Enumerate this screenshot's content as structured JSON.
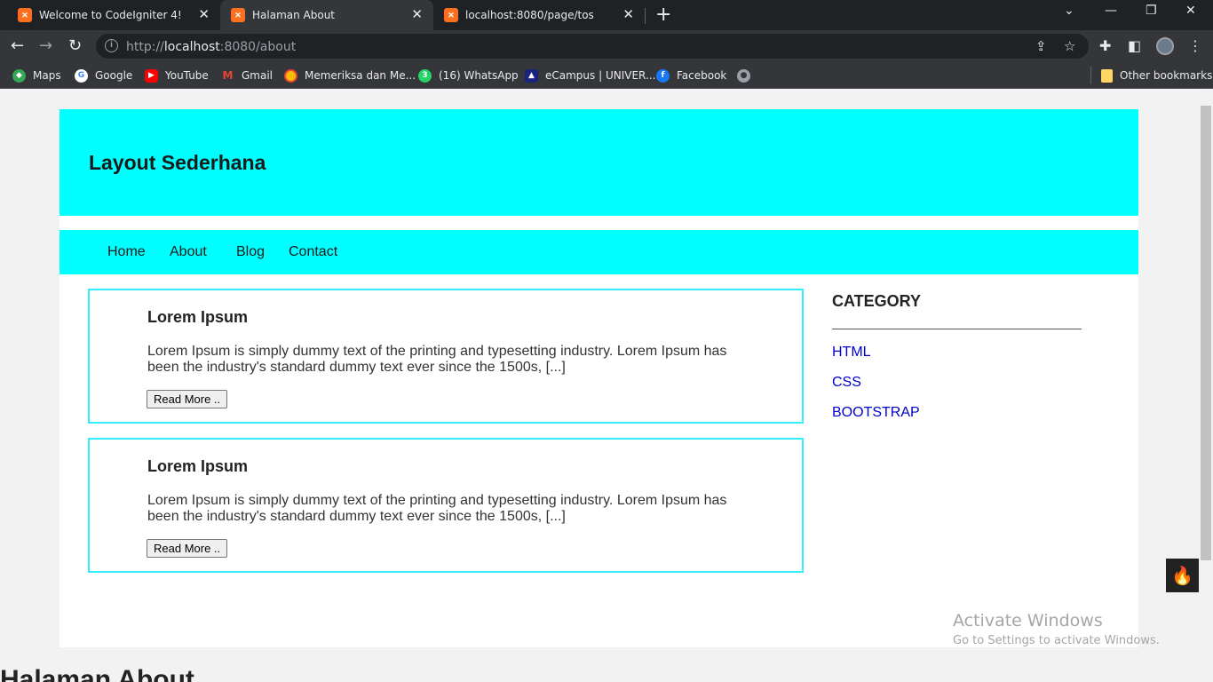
{
  "browser": {
    "tabs": [
      {
        "title": "Welcome to CodeIgniter 4!",
        "favicon": "xampp-icon",
        "active": false
      },
      {
        "title": "Halaman About",
        "favicon": "xampp-icon",
        "active": true
      },
      {
        "title": "localhost:8080/page/tos",
        "favicon": "xampp-icon",
        "active": false
      }
    ],
    "address": {
      "scheme": "http://",
      "host": "localhost",
      "rest": ":8080/about"
    },
    "bookmarks": [
      {
        "label": "Maps",
        "icon": "maps-icon"
      },
      {
        "label": "Google",
        "icon": "google-icon"
      },
      {
        "label": "YouTube",
        "icon": "youtube-icon"
      },
      {
        "label": "Gmail",
        "icon": "gmail-icon"
      },
      {
        "label": "Memeriksa dan Me...",
        "icon": "chrome-icon"
      },
      {
        "label": "(16) WhatsApp",
        "icon": "whatsapp-icon"
      },
      {
        "label": "eCampus | UNIVER...",
        "icon": "campus-icon"
      },
      {
        "label": "Facebook",
        "icon": "facebook-icon"
      },
      {
        "label": "",
        "icon": "globe-icon"
      }
    ],
    "other_bookmarks": "Other bookmarks"
  },
  "page": {
    "header_title": "Layout Sederhana",
    "nav": [
      "Home",
      "About",
      "Blog",
      "Contact"
    ],
    "articles": [
      {
        "title": "Lorem Ipsum",
        "body": "Lorem Ipsum is simply dummy text of the printing and typesetting industry. Lorem Ipsum has been the industry's standard dummy text ever since the 1500s, [...]",
        "button": "Read More .."
      },
      {
        "title": "Lorem Ipsum",
        "body": "Lorem Ipsum is simply dummy text of the printing and typesetting industry. Lorem Ipsum has been the industry's standard dummy text ever since the 1500s, [...]",
        "button": "Read More .."
      }
    ],
    "sidebar": {
      "heading": "CATEGORY",
      "links": [
        "HTML",
        "CSS",
        "BOOTSTRAP"
      ]
    },
    "bottom_heading": "Halaman About"
  },
  "overlay": {
    "activate_title": "Activate Windows",
    "activate_sub": "Go to Settings to activate Windows."
  },
  "colors": {
    "header_bg": "#00ffff",
    "article_border": "#33eeff",
    "link": "#0000cc",
    "chrome_dark": "#202124",
    "chrome_toolbar": "#35363a"
  }
}
